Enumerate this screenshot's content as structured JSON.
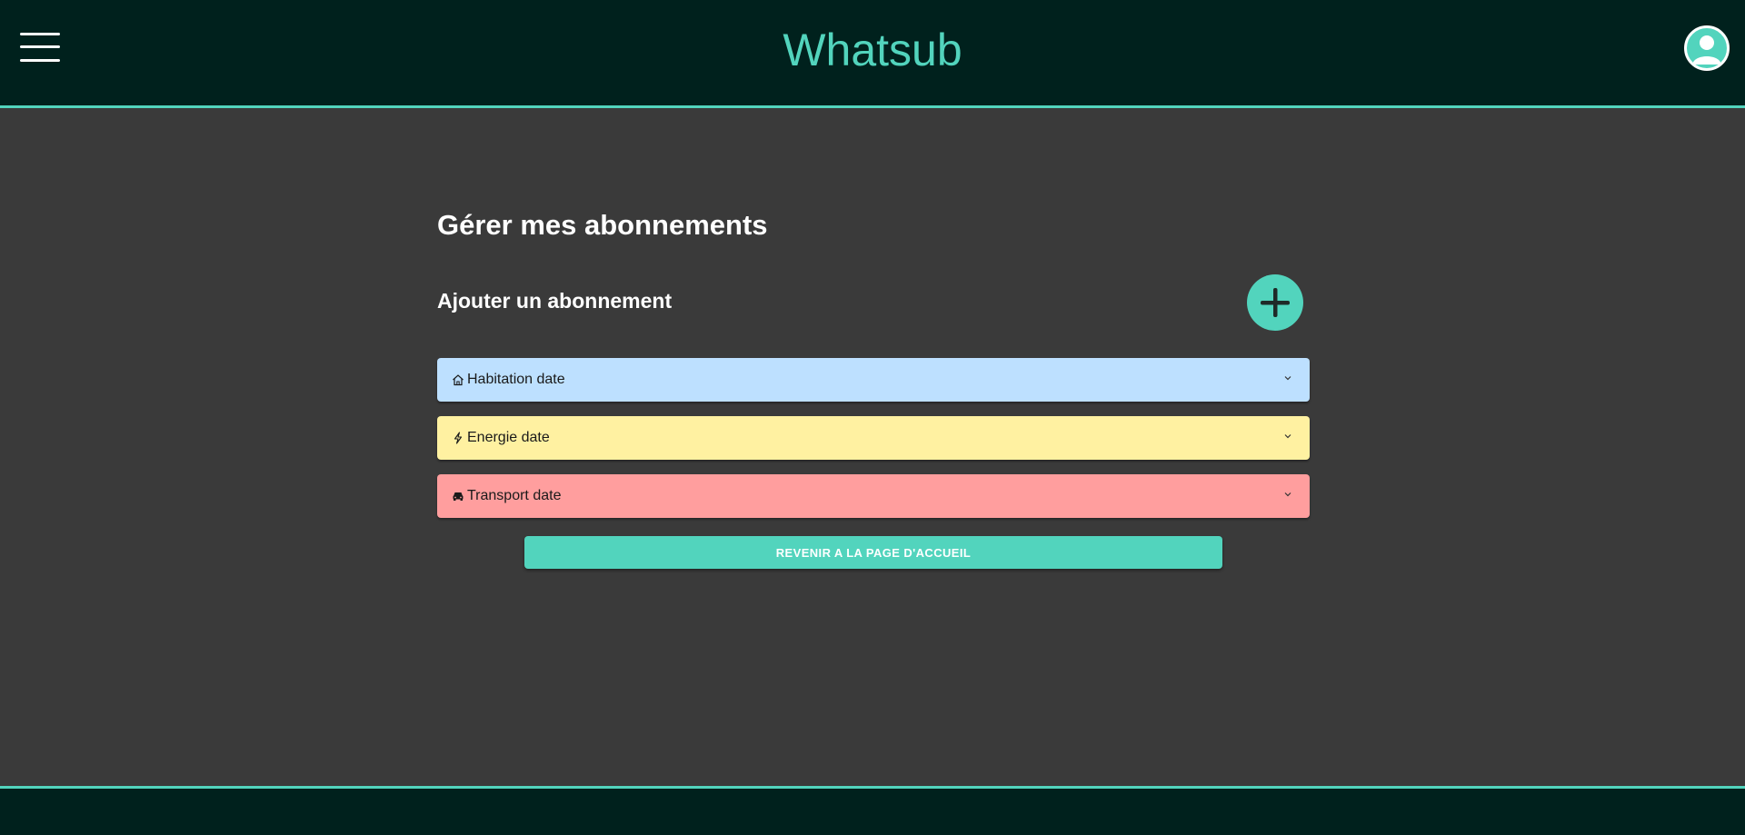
{
  "header": {
    "brand": "Whatsub",
    "menu_icon": "hamburger-menu-icon",
    "avatar_icon": "user-avatar-icon"
  },
  "main": {
    "title": "Gérer mes abonnements",
    "add_label": "Ajouter un abonnement",
    "add_icon": "plus-icon",
    "categories": [
      {
        "label": "Habitation date",
        "icon": "home-icon",
        "color": "#bde0ff"
      },
      {
        "label": "Energie date",
        "icon": "lightning-icon",
        "color": "#fff1a1"
      },
      {
        "label": "Transport date",
        "icon": "car-icon",
        "color": "#ff9e9e"
      }
    ],
    "back_button": "REVENIR A LA PAGE D'ACCUEIL"
  },
  "colors": {
    "accent": "#52d4bd",
    "header_bg": "#00211d",
    "page_bg": "#3a3a3a"
  }
}
